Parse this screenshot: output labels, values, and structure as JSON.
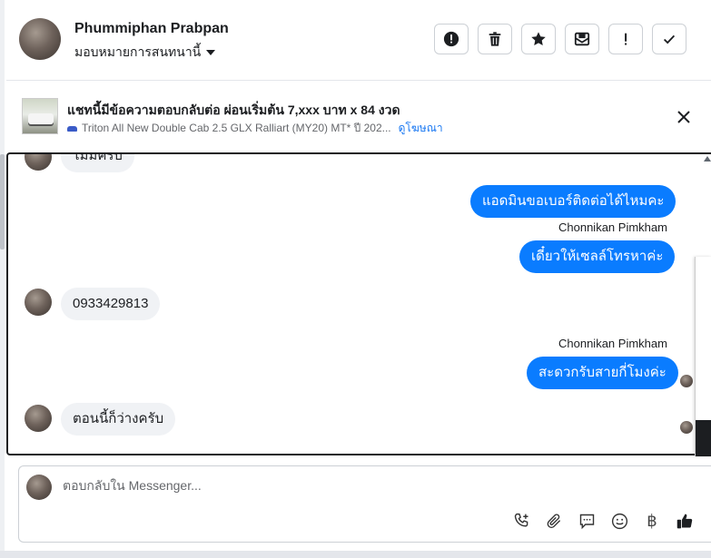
{
  "header": {
    "contact_name": "Phummiphan Prabpan",
    "assign_label": "มอบหมายการสนทนานี้"
  },
  "ad": {
    "title": "แชทนี้มีข้อความตอบกลับต่อ ผ่อนเริ่มต้น 7,xxx บาท x 84 งวด",
    "subtitle": "Triton All New Double Cab 2.5 GLX Ralliart (MY20) MT* ปี 202...",
    "link": "ดูโฆษณา"
  },
  "messages": [
    {
      "direction": "in",
      "text": "ไม่มีครับ"
    },
    {
      "direction": "out",
      "text": "แอดมินขอเบอร์ติดต่อได้ไหมคะ"
    },
    {
      "direction": "out",
      "sender": "Chonnikan Pimkham",
      "text": "เดี๋ยวให้เซลล์โทรหาค่ะ"
    },
    {
      "direction": "in",
      "text": "0933429813"
    },
    {
      "direction": "out",
      "sender": "Chonnikan Pimkham",
      "text": "สะดวกรับสายกี่โมงค่ะ"
    },
    {
      "direction": "in",
      "text": "ตอนนี้ก็ว่างครับ"
    }
  ],
  "composer": {
    "placeholder": "ตอบกลับใน Messenger...",
    "baht_symbol": "฿"
  },
  "colors": {
    "outgoing_bubble": "#0a7cff",
    "incoming_bubble": "#f0f2f5",
    "link": "#1877f2"
  },
  "icons": [
    "avatar",
    "report-icon",
    "trash-icon",
    "star-icon",
    "mark-unread-icon",
    "priority-icon",
    "check-icon",
    "close-icon",
    "add-call-icon",
    "attachment-icon",
    "saved-reply-icon",
    "emoji-icon",
    "baht-icon",
    "thumbs-up-icon"
  ]
}
